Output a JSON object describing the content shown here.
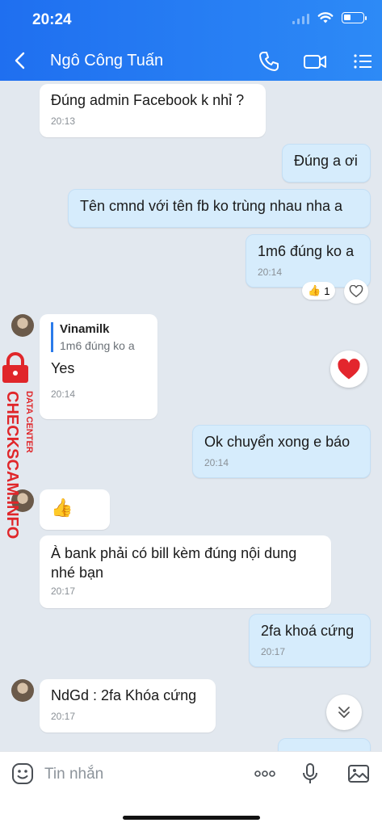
{
  "status": {
    "time": "20:24"
  },
  "header": {
    "title": "Ngô Công Tuấn"
  },
  "messages": [
    {
      "text": "Đúng admin Facebook k nhỉ ?",
      "time": "20:13"
    },
    {
      "text": "Đúng a ơi"
    },
    {
      "text": "Tên cmnd với tên fb ko trùng nhau nha a"
    },
    {
      "text": "1m6 đúng ko a",
      "time": "20:14",
      "reaction_count": "1"
    },
    {
      "quote_name": "Vinamilk",
      "quote_text": "1m6 đúng ko a",
      "text": "Yes",
      "time": "20:14"
    },
    {
      "text": "Ok chuyển xong e báo",
      "time": "20:14"
    },
    {
      "text": "👍"
    },
    {
      "text": "À bank phải có bill kèm đúng nội dung nhé bạn",
      "time": "20:17"
    },
    {
      "text": "2fa khoá cứng",
      "time": "20:17"
    },
    {
      "text": "NdGd : 2fa Khóa cứng",
      "time": "20:17"
    }
  ],
  "watermark": {
    "line1": "DATA CENTER",
    "line2": "CHECKSCAM.INFO"
  },
  "composer": {
    "placeholder": "Tin nhắn"
  },
  "colors": {
    "header": "#2d8af6",
    "bubble_out": "#d6ecfc",
    "bubble_in": "#ffffff",
    "heart": "#e3262d",
    "watermark": "#e0262a"
  }
}
